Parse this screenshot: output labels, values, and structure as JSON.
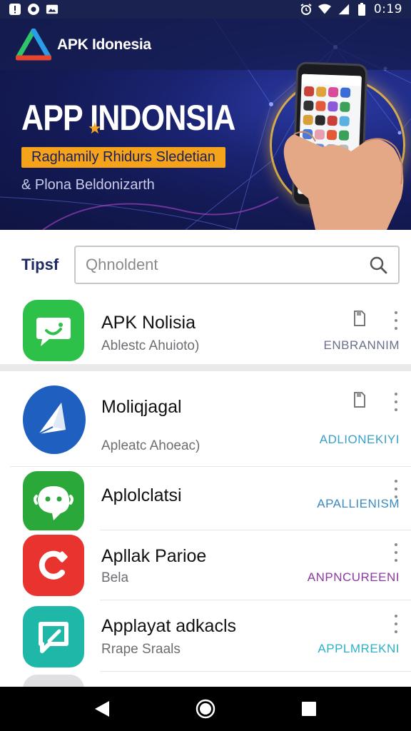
{
  "status_bar": {
    "time": "0:19",
    "icons": [
      "alert-icon",
      "messenger-icon",
      "gallery-icon",
      "alarm-icon",
      "wifi-icon",
      "signal-icon",
      "battery-icon"
    ]
  },
  "hero": {
    "brand_name": "APK Idonesia",
    "title": "APP  INDONSIA",
    "badge": "Raghamily Rhidurs Sledetian",
    "subtitle": "& Plona Beldonizarth",
    "colors": {
      "badge": "#f6a31c",
      "background": "#141a55"
    }
  },
  "search": {
    "label": "Tipsf",
    "placeholder": "Qhnoldent"
  },
  "apps": [
    {
      "name": "APK Nolisia",
      "sub": "Ablestc Ahuioto)",
      "tag": "ENBRANNIM",
      "tag_color": "#6b6f8a",
      "icon": "chat-bubble-icon",
      "icon_color": "#2ec14a"
    },
    {
      "name": "Moliqjagal",
      "sub": "Apleatc Ahoeac)",
      "tag": "ADLIONEKIYI",
      "tag_color": "#3aa0c8",
      "icon": "paper-plane-icon",
      "icon_color": "#1e5fc0"
    },
    {
      "name": "Aplolclatsi",
      "sub": "",
      "tag": "APALLIENISM",
      "tag_color": "#3a8bc0",
      "icon": "robot-chat-icon",
      "icon_color": "#2aa83a"
    },
    {
      "name": "Apllak Parioe",
      "sub": "Bela",
      "tag": "ANPNCUREENI",
      "tag_color": "#8a3aa0",
      "icon": "phone-c-icon",
      "icon_color": "#e8332f"
    },
    {
      "name": "Applayat adkacls",
      "sub": "Rrape Sraals",
      "tag": "APPLMREKNI",
      "tag_color": "#2ab0c8",
      "icon": "message-square-icon",
      "icon_color": "#1fb8a8"
    }
  ],
  "nav": {
    "icons": [
      "back-icon",
      "home-icon",
      "recents-icon"
    ]
  }
}
